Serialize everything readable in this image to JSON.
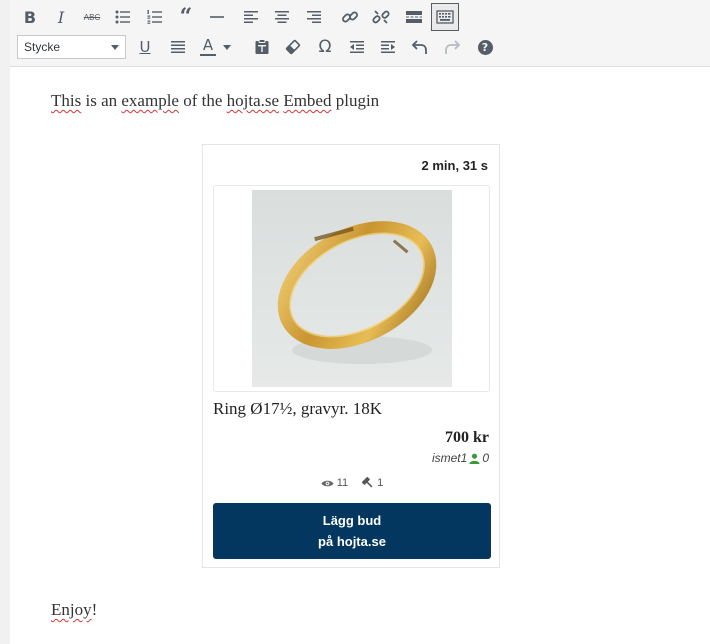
{
  "toolbar": {
    "format_select": {
      "value": "Stycke"
    },
    "row1": [
      "bold",
      "italic",
      "strikethrough",
      "bulleted-list",
      "numbered-list",
      "blockquote",
      "horizontal-line",
      "align-left",
      "align-center",
      "align-right",
      "insert-link",
      "remove-link",
      "read-more",
      "toolbar-toggle"
    ],
    "row2": [
      "underline",
      "justify",
      "text-color",
      "paste-as-text",
      "clear-formatting",
      "special-character",
      "outdent",
      "indent",
      "undo",
      "redo",
      "help"
    ],
    "bold_label": "B",
    "italic_label": "I",
    "strike_label": "ABC",
    "underline_label": "U",
    "textcolor_label": "A",
    "omega_label": "Ω",
    "help_label": "?"
  },
  "content": {
    "intro": {
      "w1": "This",
      "w2": "is an",
      "w3": "example",
      "w4": "of the",
      "w5": "hojta.se",
      "w6": "Embed",
      "w7": "plugin"
    },
    "outro": "Enjoy",
    "outro_mark": "!"
  },
  "embed": {
    "time_left": "2 min, 31 s",
    "item_title": "Ring Ø17½, gravyr. 18K",
    "price": "700 kr",
    "seller": "ismet1",
    "rating": "0",
    "views": "11",
    "bids": "1",
    "bid_button_line1": "Lägg bud",
    "bid_button_line2": "på hojta.se"
  },
  "colors": {
    "bid_button_bg": "#03375f",
    "rating_icon": "#3a9a3a",
    "spellcheck": "#d63638"
  }
}
